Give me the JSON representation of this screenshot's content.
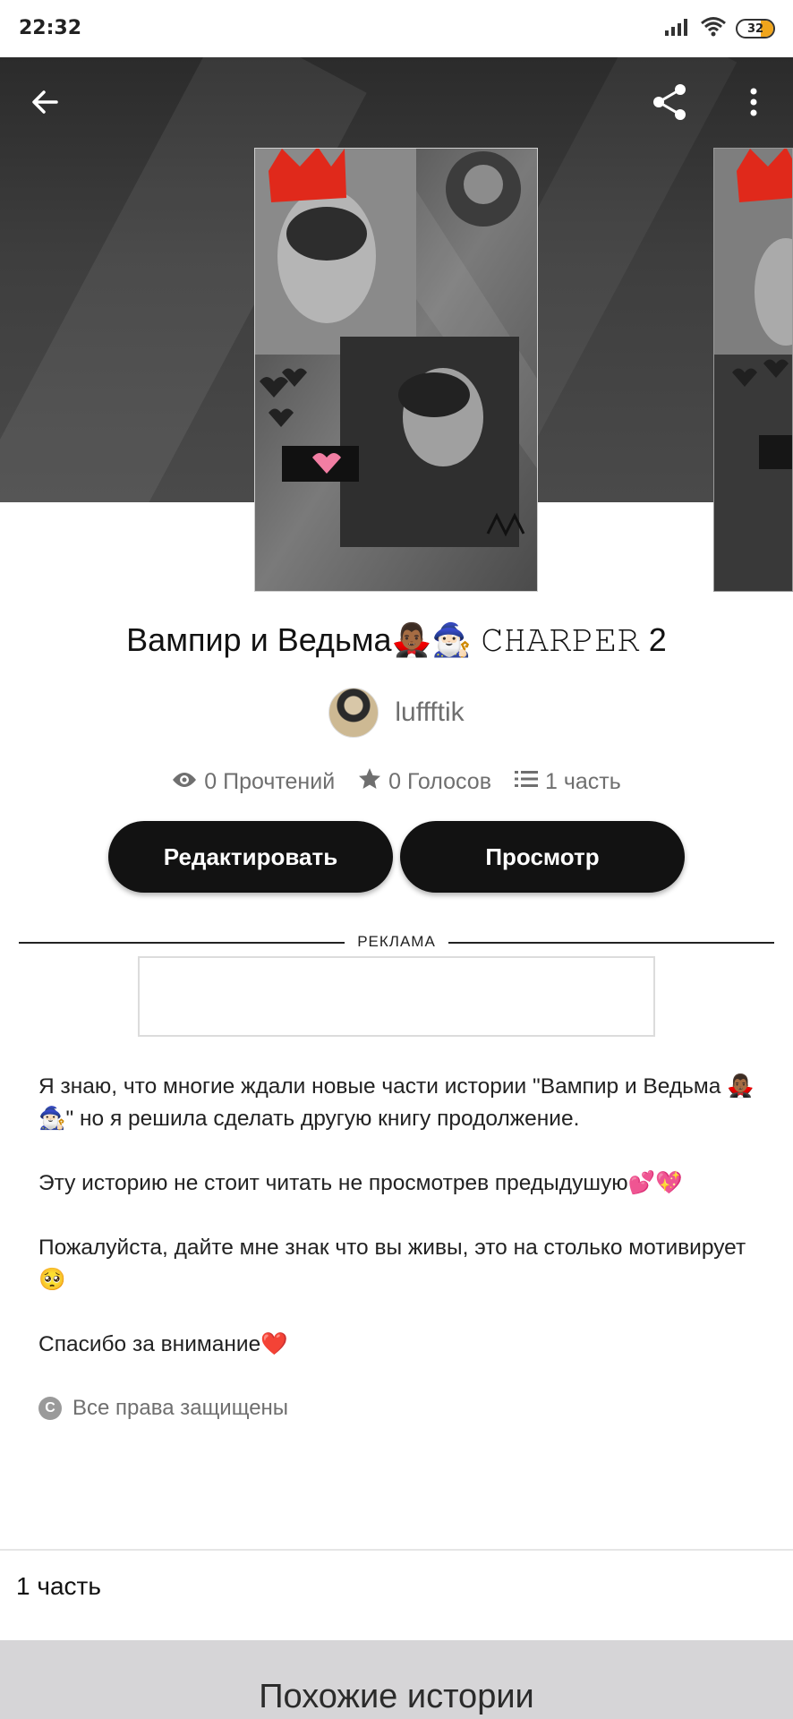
{
  "status_bar": {
    "time": "22:32",
    "battery": "32",
    "icons": [
      "signal-icon",
      "wifi-icon",
      "battery-icon"
    ]
  },
  "header": {
    "back_icon": "back-arrow-icon",
    "share_icon": "share-icon",
    "menu_icon": "more-vert-icon"
  },
  "story": {
    "title": "Вампир и Ведьма🧛🏾‍♂️🧙🏻‍♂️ 𝙲𝙷𝙰𝚁𝙿𝙴𝚁 2",
    "author": "luffftik",
    "stats": {
      "reads": "0 Прочтений",
      "votes": "0 Голосов",
      "parts": "1 часть"
    }
  },
  "actions": {
    "edit_label": "Редактировать",
    "view_label": "Просмотр"
  },
  "ad": {
    "label": "РЕКЛАМА"
  },
  "description": {
    "p1": "Я знаю, что многие ждали новые части истории \"Вампир и Ведьма 🧛🏾‍♂️🧙🏻‍♂️\" но я решила сделать другую книгу продолжение.",
    "p2": "Эту историю не стоит читать не просмотрев предыдушую💕💖",
    "p3": "Пожалуйста, дайте мне знак что вы живы, это на столько мотивирует🥺",
    "p4": "Спасибо за внимание❤️"
  },
  "copyright": {
    "icon_glyph": "C",
    "text": "Все права защищены"
  },
  "parts_section": {
    "label": "1 часть"
  },
  "similar": {
    "title": "Похожие истории"
  },
  "colors": {
    "primary_button": "#121212",
    "header_bg": "#333333",
    "similar_bg": "#d6d5d7",
    "muted_text": "#6f6f6f"
  }
}
